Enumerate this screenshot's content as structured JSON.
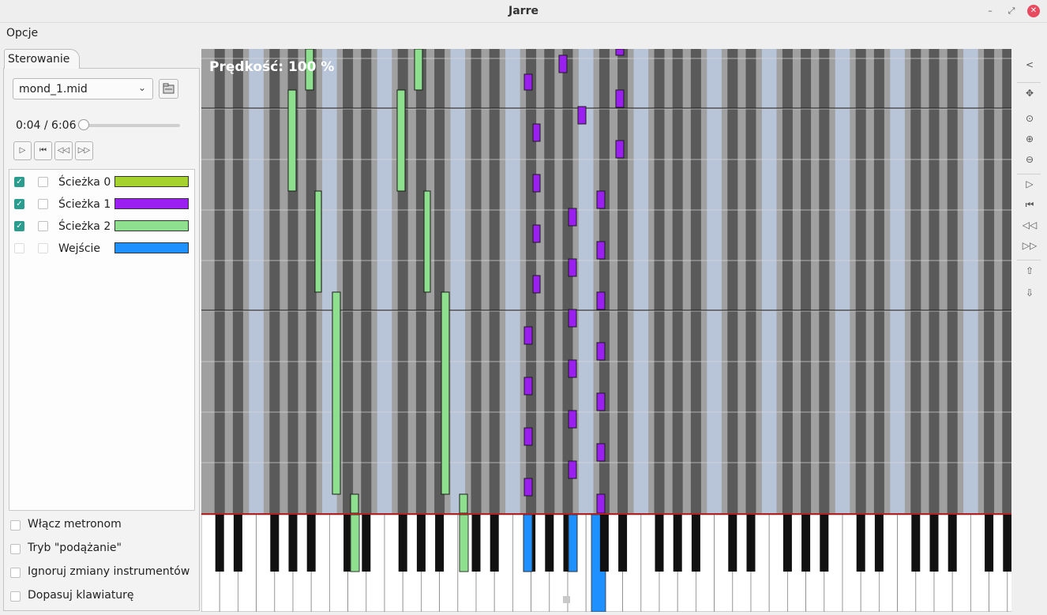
{
  "window": {
    "title": "Jarre",
    "min_icon": "minimize-icon",
    "max_icon": "maximize-icon",
    "close_icon": "close-icon"
  },
  "menu": {
    "options": "Opcje"
  },
  "tab": {
    "label": "Sterowanie"
  },
  "file": {
    "selected": "mond_1.mid"
  },
  "playback": {
    "time": "0:04 / 6:06",
    "position_fraction": 0.011
  },
  "tracks": [
    {
      "name": "Ścieżka 0",
      "enabled": true,
      "color": "#a6d22e"
    },
    {
      "name": "Ścieżka 1",
      "enabled": true,
      "color": "#9b1ff0"
    },
    {
      "name": "Ścieżka 2",
      "enabled": true,
      "color": "#8ee08e"
    },
    {
      "name": "Wejście",
      "enabled": false,
      "color": "#1e90ff"
    }
  ],
  "options": {
    "metronome": "Włącz metronom",
    "follow": "Tryb \"podążanie\"",
    "ignore_instruments": "Ignoruj zmiany instrumentów",
    "fit_keyboard": "Dopasuj klawiaturę"
  },
  "roll": {
    "speed_label": "Prędkość: 100 %"
  },
  "colors": {
    "black_column": "#5a5a5a",
    "white_column": "#a0a0a0",
    "pale_column": "#b8c4d8",
    "pressed": "#1e90ff"
  },
  "right_toolbar": [
    "collapse-icon",
    "move-icon",
    "zoom-fit-icon",
    "zoom-in-icon",
    "zoom-out-icon",
    "play-icon",
    "rewind-start-icon",
    "step-back-icon",
    "step-forward-icon",
    "arrow-up-icon",
    "arrow-down-icon"
  ]
}
